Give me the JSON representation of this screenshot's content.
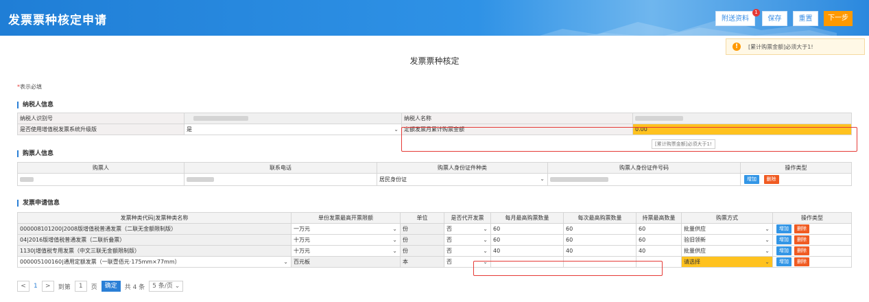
{
  "header": {
    "title": "发票票种核定申请",
    "buttons": {
      "attach": "附送资料",
      "save": "保存",
      "reset": "重置",
      "next": "下一步"
    },
    "badge": "1"
  },
  "toast": {
    "icon": "!",
    "text": "[累计购票金额]必须大于1!"
  },
  "page_title": "发票票种核定",
  "required_note": {
    "star": "*",
    "text": "表示必填"
  },
  "taxpayer": {
    "section_title": "纳税人信息",
    "id_label": "纳税人识别号",
    "name_label": "纳税人名称",
    "upgrade_label": "是否使用增值税发票系统升级版",
    "upgrade_value": "是",
    "amount_label": "定额发票月累计购票金额",
    "amount_value": "0.00",
    "amount_tip": "[累计购票金额]必须大于1!"
  },
  "buyer": {
    "section_title": "购票人信息",
    "headers": [
      "购票人",
      "联系电话",
      "购票人身份证件种类",
      "购票人身份证件号码",
      "操作类型"
    ],
    "id_type": "居民身份证",
    "add": "增加",
    "del": "删除"
  },
  "invoice": {
    "section_title": "发票申请信息",
    "headers": [
      "发票种类代码|发票种类名称",
      "单份发票最高开票限额",
      "单位",
      "是否代开发票",
      "每月最高购票数量",
      "每次最高购票数量",
      "持票最高数量",
      "购票方式",
      "操作类型"
    ],
    "rows": [
      {
        "name": "000008101200|2008版增值税普通发票（二联无金额限制版）",
        "limit": "一万元",
        "unit": "份",
        "proxy": "否",
        "monthly": "60",
        "each": "60",
        "hold": "60",
        "method": "批量供应"
      },
      {
        "name": "04|2016版增值税普通发票（二联折叠票）",
        "limit": "十万元",
        "unit": "份",
        "proxy": "否",
        "monthly": "60",
        "each": "60",
        "hold": "60",
        "method": "验旧领新"
      },
      {
        "name": "1130|增值税专用发票（中文三联无金额限制版）",
        "limit": "十万元",
        "unit": "份",
        "proxy": "否",
        "monthly": "40",
        "each": "40",
        "hold": "40",
        "method": "批量供应"
      },
      {
        "name": "000005100160|通用定额发票（一联壹佰元·175mm×77mm）",
        "limit": "百元板",
        "unit": "本",
        "proxy": "否",
        "monthly": "",
        "each": "",
        "hold": "",
        "method": "请选择"
      }
    ],
    "add": "增加",
    "del": "删除"
  },
  "pager": {
    "prev": "<",
    "current": "1",
    "next": ">",
    "goto_label": "到第",
    "goto_value": "1",
    "page_label": "页",
    "confirm": "确定",
    "total": "共 4 条",
    "size": "5 条/页"
  },
  "colors": {
    "header": "#2a88de",
    "accent": "#ff9900",
    "highlight": "#ffc21f",
    "error": "#e53935"
  }
}
